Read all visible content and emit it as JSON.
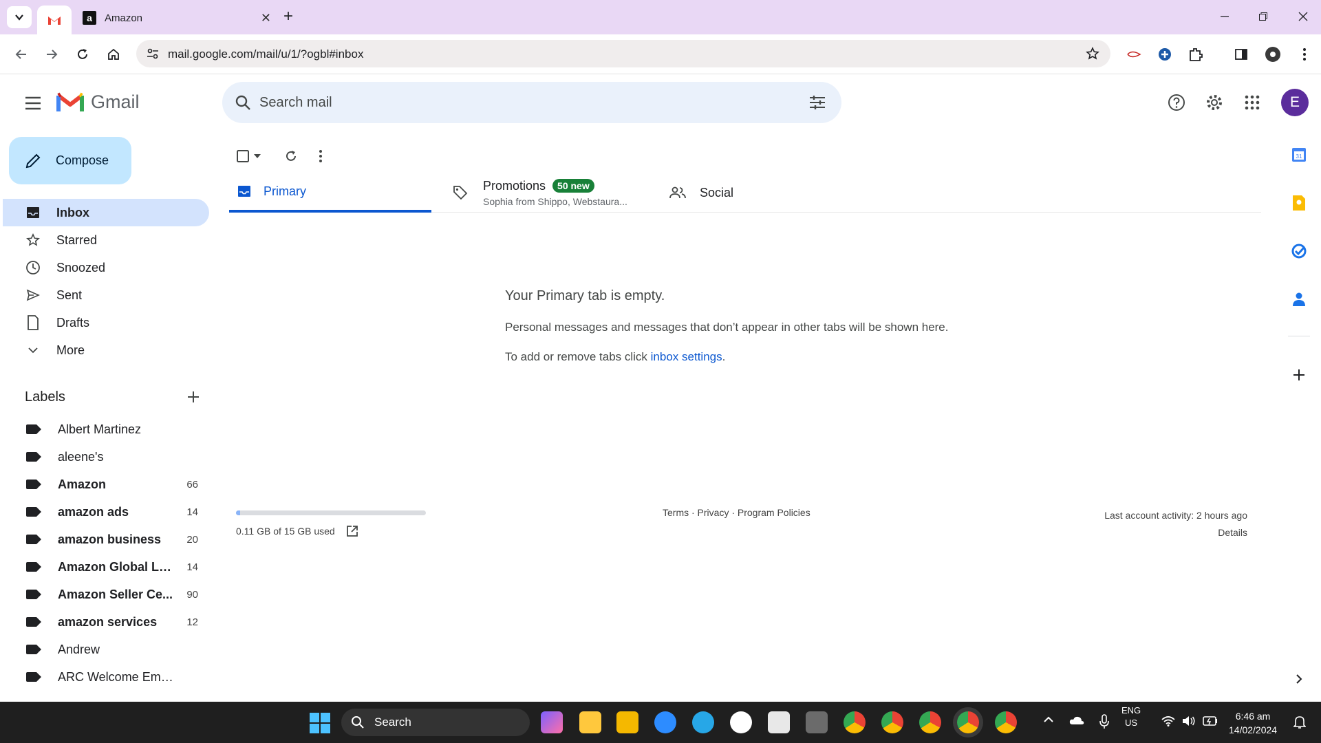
{
  "browser": {
    "tabs": [
      {
        "label": "",
        "icon": "gmail-icon"
      },
      {
        "label": "Amazon",
        "icon": "amazon-icon",
        "favicon_text": "a"
      }
    ],
    "url": "mail.google.com/mail/u/1/?ogbl#inbox"
  },
  "gmail": {
    "brand": "Gmail",
    "search_placeholder": "Search mail",
    "avatar_letter": "E",
    "compose_label": "Compose",
    "nav": [
      {
        "label": "Inbox",
        "icon": "inbox-icon",
        "active": true
      },
      {
        "label": "Starred",
        "icon": "star-icon"
      },
      {
        "label": "Snoozed",
        "icon": "clock-icon"
      },
      {
        "label": "Sent",
        "icon": "send-icon"
      },
      {
        "label": "Drafts",
        "icon": "draft-icon"
      },
      {
        "label": "More",
        "icon": "chevron-down-icon"
      }
    ],
    "labels_heading": "Labels",
    "labels": [
      {
        "name": "Albert Martinez",
        "count": "",
        "bold": false
      },
      {
        "name": "aleene's",
        "count": "",
        "bold": false
      },
      {
        "name": "Amazon",
        "count": "66",
        "bold": true
      },
      {
        "name": "amazon ads",
        "count": "14",
        "bold": true
      },
      {
        "name": "amazon business",
        "count": "20",
        "bold": true
      },
      {
        "name": "Amazon Global Lo...",
        "count": "14",
        "bold": true
      },
      {
        "name": "Amazon Seller Ce...",
        "count": "90",
        "bold": true
      },
      {
        "name": "amazon services",
        "count": "12",
        "bold": true
      },
      {
        "name": "Andrew",
        "count": "",
        "bold": false
      },
      {
        "name": "ARC Welcome Emails",
        "count": "",
        "bold": false
      }
    ],
    "inbox_tabs": {
      "primary": "Primary",
      "promotions": "Promotions",
      "promotions_badge": "50 new",
      "promotions_sub": "Sophia from Shippo, Webstaura...",
      "social": "Social"
    },
    "empty_state": {
      "heading": "Your Primary tab is empty.",
      "line1": "Personal messages and messages that don’t appear in other tabs will be shown here.",
      "line2_prefix": "To add or remove tabs click ",
      "line2_link": "inbox settings",
      "line2_suffix": "."
    },
    "footer": {
      "storage_text": "0.11 GB of 15 GB used",
      "storage_fraction": 0.0073,
      "links": "Terms · Privacy · Program Policies",
      "last_activity": "Last account activity: 2 hours ago",
      "details": "Details"
    }
  },
  "taskbar": {
    "search_label": "Search",
    "lang_top": "ENG",
    "lang_bottom": "US",
    "time": "6:46 am",
    "date": "14/02/2024"
  },
  "colors": {
    "accent": "#0b57d0",
    "compose_bg": "#c2e7ff",
    "active_nav_bg": "#d3e3fd",
    "search_bg": "#eaf1fb",
    "promo_badge": "#188038",
    "tabbar": "#e9d8f5",
    "avatar": "#5b2d9c"
  }
}
